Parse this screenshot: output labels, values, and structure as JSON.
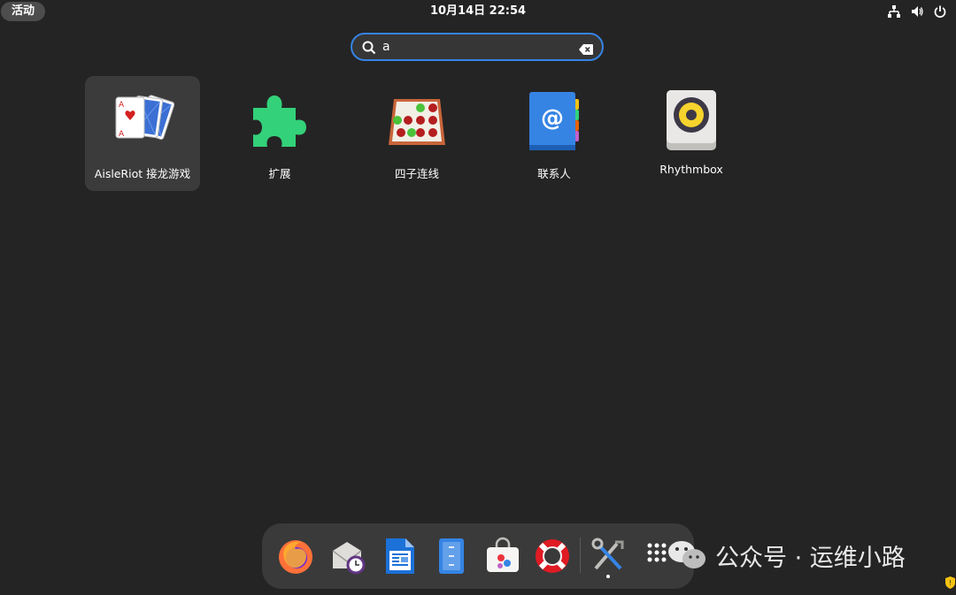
{
  "topbar": {
    "activities_label": "活动",
    "clock": "10月14日  22:54",
    "tray_icons": [
      "network-icon",
      "volume-icon",
      "power-icon"
    ]
  },
  "search": {
    "value": "a",
    "icons": [
      "search-icon",
      "clear-icon"
    ]
  },
  "results": [
    {
      "label": "AisleRiot 接龙游戏",
      "icon": "playing-cards-icon",
      "selected": true
    },
    {
      "label": "扩展",
      "icon": "puzzle-piece-icon",
      "selected": false
    },
    {
      "label": "四子连线",
      "icon": "four-in-a-row-icon",
      "selected": false
    },
    {
      "label": "联系人",
      "icon": "contacts-book-icon",
      "selected": false
    },
    {
      "label": "Rhythmbox",
      "icon": "speaker-icon",
      "selected": false
    }
  ],
  "dock": {
    "items": [
      "firefox-icon",
      "mail-clock-icon",
      "writer-icon",
      "files-icon",
      "software-store-icon",
      "help-lifebuoy-icon",
      "utilities-tools-icon",
      "app-grid-icon"
    ]
  },
  "watermark": {
    "text": "公众号 · 运维小路"
  },
  "colors": {
    "background": "#242424",
    "accent": "#3584e4",
    "selected_tile": "#3b3b3b",
    "dock": "#3a3a3a"
  }
}
